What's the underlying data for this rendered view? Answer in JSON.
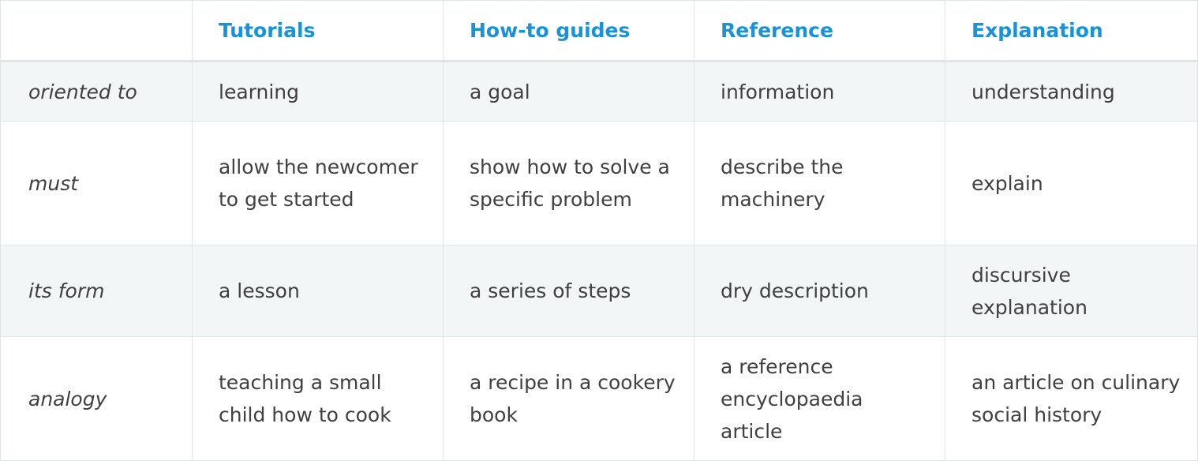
{
  "header": {
    "corner": "",
    "columns": [
      "Tutorials",
      "How-to guides",
      "Reference",
      "Explanation"
    ]
  },
  "rows": [
    {
      "label": "oriented to",
      "cells": [
        "learning",
        "a goal",
        "information",
        "understanding"
      ]
    },
    {
      "label": "must",
      "cells": [
        "allow the newcomer to get started",
        "show how to solve a specific problem",
        "describe the machinery",
        "explain"
      ]
    },
    {
      "label": "its form",
      "cells": [
        "a lesson",
        "a series of steps",
        "dry description",
        "discursive explanation"
      ]
    },
    {
      "label": "analogy",
      "cells": [
        "teaching a small child how to cook",
        "a recipe in a cookery book",
        "a reference encyclopaedia article",
        "an article on culinary social history"
      ]
    }
  ],
  "colors": {
    "header_text": "#1a92d8",
    "body_text": "#404040",
    "shaded_row": "#f3f6f6",
    "border": "#e1e4e5"
  }
}
